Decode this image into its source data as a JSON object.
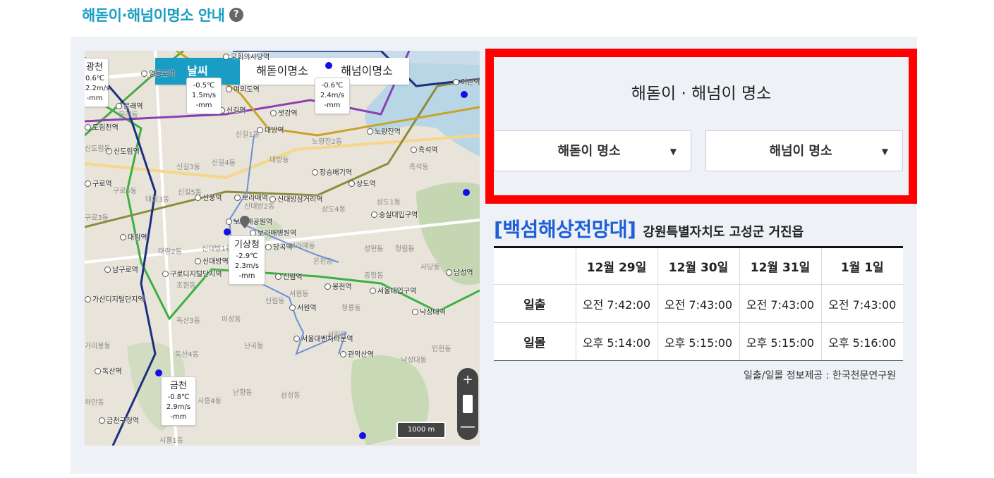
{
  "page": {
    "title": "해돋이·해넘이명소 안내",
    "help_icon": "?"
  },
  "map": {
    "tabs": [
      {
        "label": "날씨",
        "active": true
      },
      {
        "label": "해돋이명소",
        "active": false
      },
      {
        "label": "해넘이명소",
        "active": false
      }
    ],
    "weather_cards": [
      {
        "name": "",
        "temp": "-0.5℃",
        "wind": "1.5m/s",
        "rain": "-mm"
      },
      {
        "name": "",
        "temp": "-0.6℃",
        "wind": "2.4m/s",
        "rain": "-mm"
      },
      {
        "name": "광천",
        "temp": "0.6℃",
        "wind": "2.2m/s",
        "rain": "-mm"
      },
      {
        "name": "기상청",
        "temp": "-2.9℃",
        "wind": "2.3m/s",
        "rain": "-mm"
      },
      {
        "name": "금천",
        "temp": "-0.8℃",
        "wind": "2.9m/s",
        "rain": "-mm"
      }
    ],
    "stations": [
      "국회의사당역",
      "여의도역",
      "신길역",
      "샛강역",
      "대방역",
      "노량진역",
      "흑석역",
      "신도림역",
      "도림천역",
      "구로역",
      "신풍역",
      "보라매역",
      "신대방삼거리역",
      "장승배기역",
      "상도역",
      "숭실대입구역",
      "대림역",
      "남구로역",
      "구로디지털단지역",
      "신대방역",
      "신림역",
      "봉천역",
      "서울대입구역",
      "낙성대역",
      "가산디지털단지역",
      "서원역",
      "서울대벤처타운역",
      "관악산역",
      "독산역",
      "금천구청역",
      "이촌역",
      "보라매병원역",
      "당곡역",
      "보라매공원역",
      "문래역",
      "영등포역",
      "남성역"
    ],
    "dongs": [
      "문래동",
      "신길1동",
      "신길3동",
      "신길4동",
      "신길5동",
      "대림2동",
      "대림3동",
      "신대방1동",
      "신대방2동",
      "보라매동",
      "상도4동",
      "성현동",
      "청림동",
      "신림동",
      "서원동",
      "미성동",
      "난곡동",
      "난향동",
      "삼성동",
      "독산3동",
      "독산4동",
      "시흥1동",
      "시흥4동",
      "조원동",
      "구로5동",
      "노량진2동",
      "흑석동",
      "신도림동",
      "사당동",
      "인헌동",
      "낙성대동",
      "서림동",
      "청룡동",
      "중앙동",
      "은천동",
      "구로3동",
      "가리봉동",
      "하안동",
      "대방동",
      "상도1동"
    ],
    "scale": "1000 m",
    "zoom_plus": "+",
    "zoom_minus": "—"
  },
  "selector": {
    "title": "해돋이 · 해넘이 명소",
    "sunrise_dropdown": "해돋이 명소",
    "sunset_dropdown": "해넘이 명소",
    "arrow": "▼"
  },
  "place": {
    "name": "[백섬해상전망대]",
    "address": "강원특별자치도 고성군 거진읍"
  },
  "table": {
    "dates": [
      "12월 29일",
      "12월 30일",
      "12월 31일",
      "1월 1일"
    ],
    "rows": [
      {
        "label": "일출",
        "values": [
          "오전 7:42:00",
          "오전 7:43:00",
          "오전 7:43:00",
          "오전 7:43:00"
        ]
      },
      {
        "label": "일몰",
        "values": [
          "오후 5:14:00",
          "오후 5:15:00",
          "오후 5:15:00",
          "오후 5:16:00"
        ]
      }
    ]
  },
  "source_note": "일출/일몰 정보제공 : 한국천문연구원",
  "colors": {
    "accent": "#1a9dc4",
    "highlight_border": "#ff0000",
    "place_name": "#1e5fd8"
  }
}
